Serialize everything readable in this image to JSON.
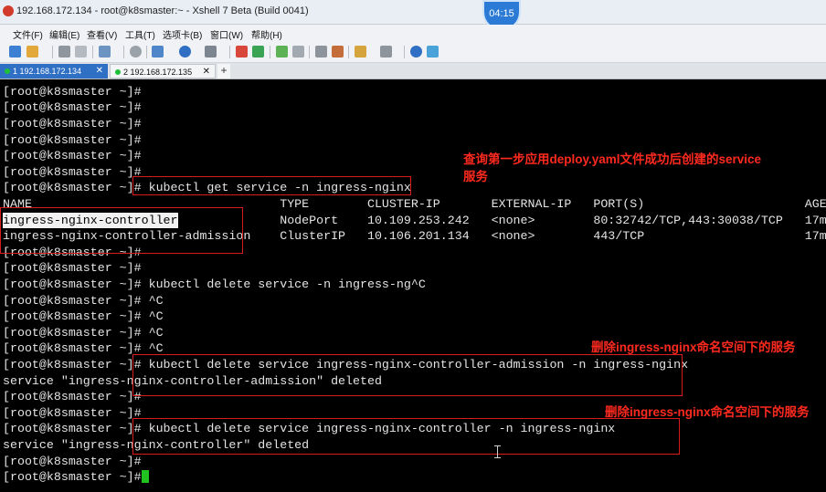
{
  "window": {
    "title": "192.168.172.134 - root@k8smaster:~ - Xshell 7 Beta (Build 0041)",
    "clock": "04:15"
  },
  "menu": [
    "文件(F)",
    "编辑(E)",
    "查看(V)",
    "工具(T)",
    "选项卡(B)",
    "窗口(W)",
    "帮助(H)"
  ],
  "tabs": [
    {
      "label": "1 192.168.172.134",
      "active": true
    },
    {
      "label": "2 192.168.172.135",
      "active": false
    }
  ],
  "terminal": {
    "lines": [
      "[root@k8smaster ~]#",
      "[root@k8smaster ~]#",
      "[root@k8smaster ~]#",
      "[root@k8smaster ~]#",
      "[root@k8smaster ~]#",
      "[root@k8smaster ~]#",
      "[root@k8smaster ~]# kubectl get service -n ingress-nginx",
      "NAME                                  TYPE        CLUSTER-IP       EXTERNAL-IP   PORT(S)                      AGE",
      "ingress-nginx-controller              NodePort    10.109.253.242   <none>        80:32742/TCP,443:30038/TCP   17m",
      "ingress-nginx-controller-admission    ClusterIP   10.106.201.134   <none>        443/TCP                      17m",
      "[root@k8smaster ~]#",
      "[root@k8smaster ~]#",
      "[root@k8smaster ~]# kubectl delete service -n ingress-ng^C",
      "[root@k8smaster ~]# ^C",
      "[root@k8smaster ~]# ^C",
      "[root@k8smaster ~]# ^C",
      "[root@k8smaster ~]# ^C",
      "[root@k8smaster ~]# kubectl delete service ingress-nginx-controller-admission -n ingress-nginx",
      "service \"ingress-nginx-controller-admission\" deleted",
      "[root@k8smaster ~]#",
      "[root@k8smaster ~]#",
      "[root@k8smaster ~]# kubectl delete service ingress-nginx-controller -n ingress-nginx",
      "service \"ingress-nginx-controller\" deleted",
      "[root@k8smaster ~]#",
      "[root@k8smaster ~]#"
    ],
    "highlighted_name": "ingress-nginx-controller"
  },
  "annotations": {
    "note1_line1": "查询第一步应用deploy.yaml文件成功后创建的service",
    "note1_line2": "服务",
    "note2": "删除ingress-nginx命名空间下的服务",
    "note3": "删除ingress-nginx命名空间下的服务"
  },
  "colors": {
    "terminal_bg": "#000000",
    "terminal_fg": "#e4e4e4",
    "annotation": "#ff2a1f",
    "cursor": "#21c21f",
    "active_tab": "#2f6fc4"
  }
}
